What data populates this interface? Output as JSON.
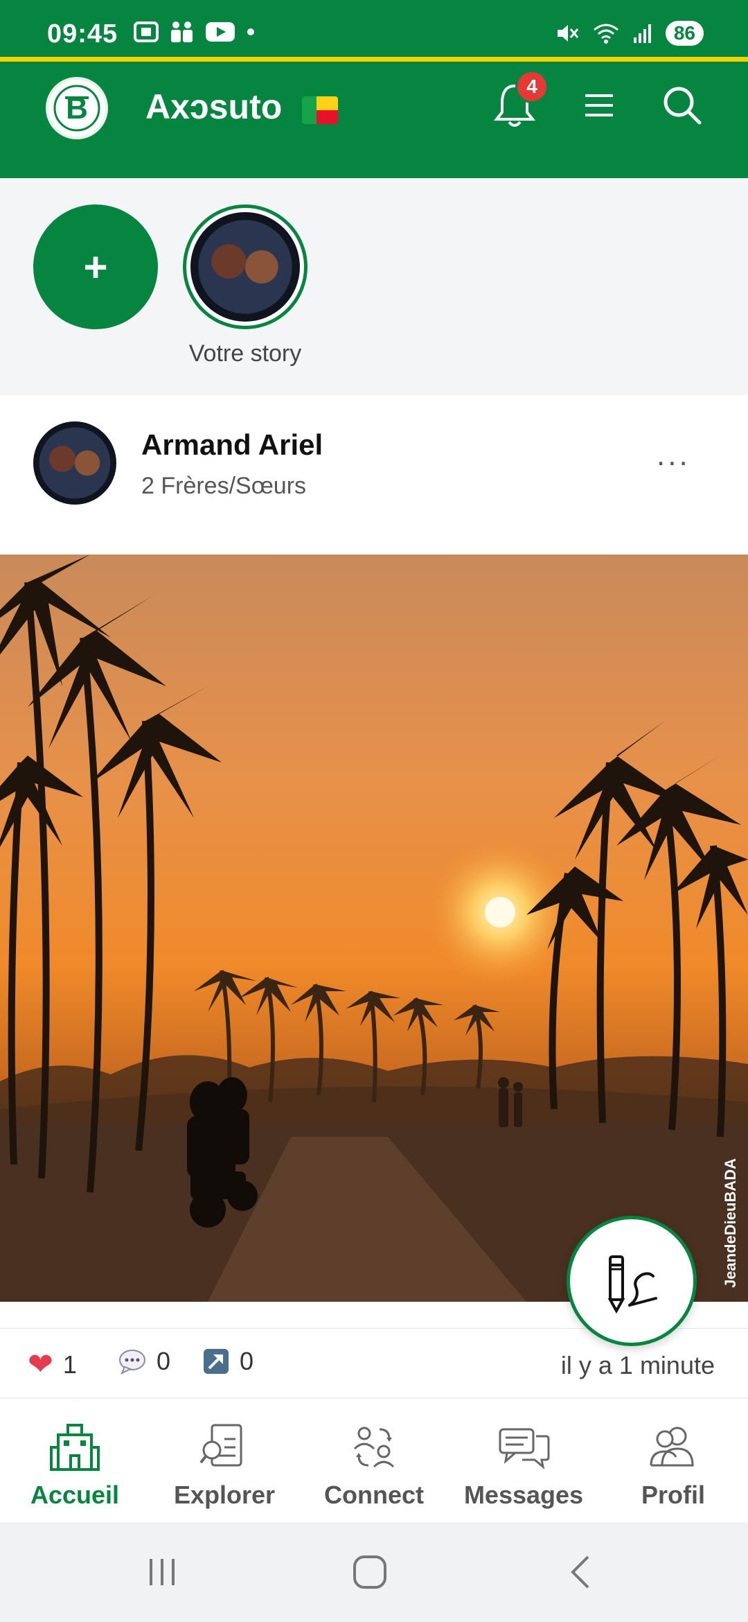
{
  "status_bar": {
    "time": "09:45",
    "battery": "86"
  },
  "header": {
    "app_name": "Axɔsuto",
    "notification_count": "4",
    "brand_color": "#05853f"
  },
  "stories": {
    "add_label": "+",
    "items": [
      {
        "label": "Votre story"
      }
    ]
  },
  "post": {
    "author": "Armand Ariel",
    "subtitle": "2 Frères/Sœurs",
    "more": "...",
    "image_watermark": "JeandeDieuBADA",
    "likes": "1",
    "comments": "0",
    "shares": "0",
    "time_ago": "il y a 1 minute"
  },
  "bottom_nav": {
    "items": [
      {
        "label": "Accueil",
        "icon": "building-icon",
        "active": true
      },
      {
        "label": "Explorer",
        "icon": "explore-icon",
        "active": false
      },
      {
        "label": "Connect",
        "icon": "connect-icon",
        "active": false
      },
      {
        "label": "Messages",
        "icon": "messages-icon",
        "active": false
      },
      {
        "label": "Profil",
        "icon": "profile-icon",
        "active": false
      }
    ]
  }
}
